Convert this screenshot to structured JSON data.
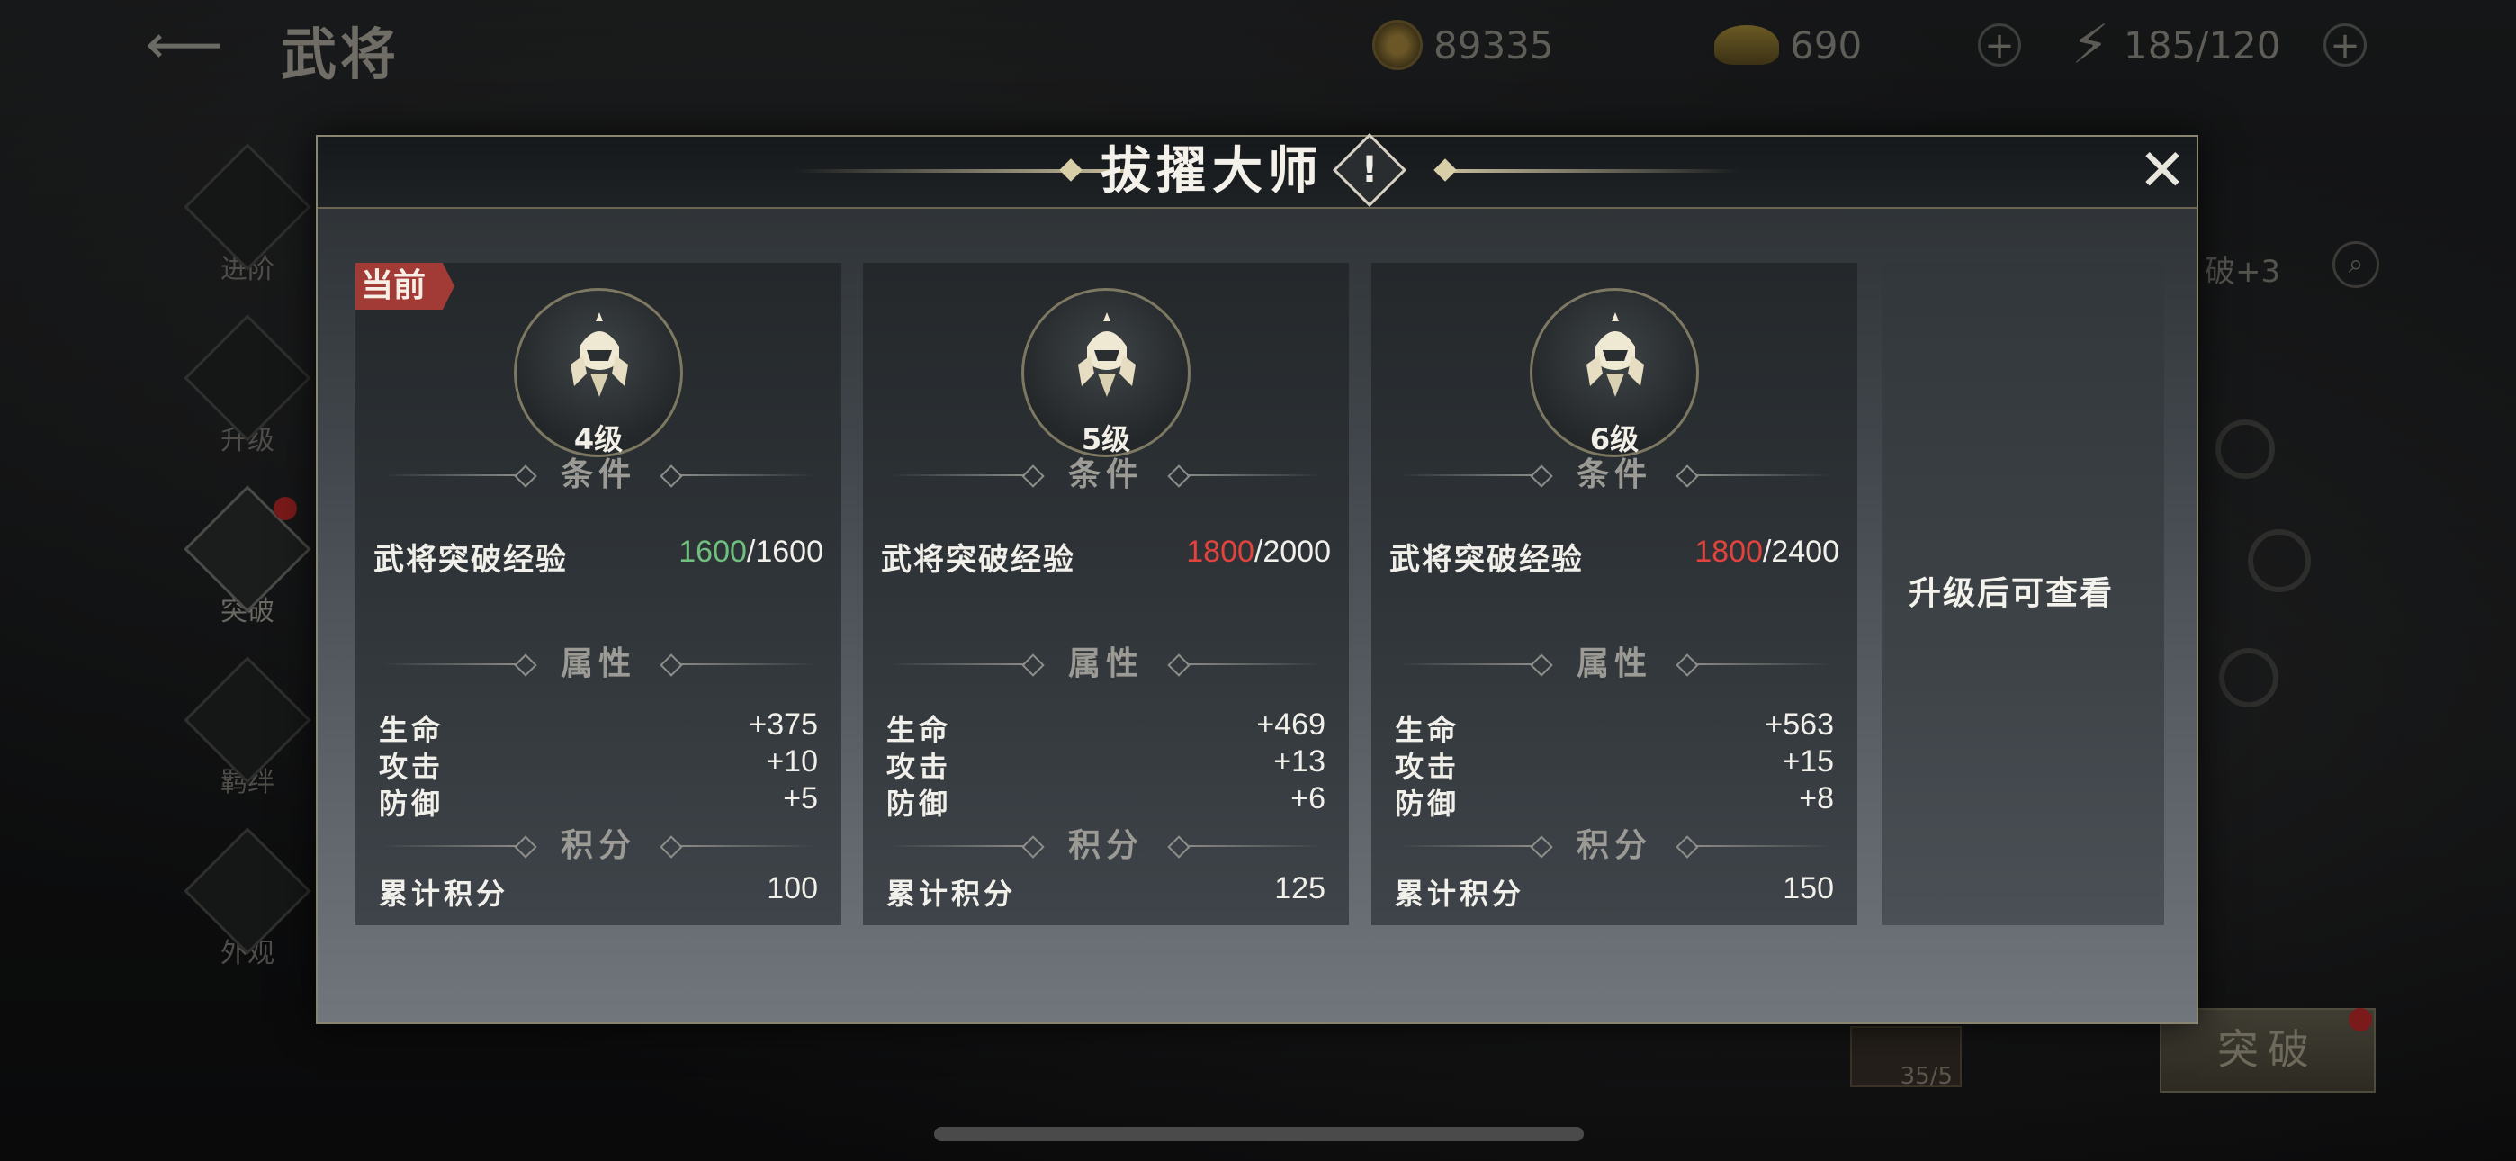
{
  "background": {
    "page_title": "武将",
    "back_icon": "back-arrow-icon",
    "resources": {
      "coins": "89335",
      "ingots": "690",
      "stamina": "185/120"
    },
    "side_nav": [
      "进阶",
      "升级",
      "突破",
      "羁绊",
      "外观"
    ],
    "right_label": "破+3",
    "breakthrough_button": "突破",
    "portrait_count": "35/5"
  },
  "modal": {
    "title": "拔擢大师",
    "info_icon": "!",
    "close_icon": "✕",
    "current_tag": "当前",
    "cards": [
      {
        "level": "4级",
        "condition_header": "条件",
        "condition_label": "武将突破经验",
        "condition_current": "1600",
        "condition_total": "/1600",
        "condition_met": true,
        "attr_header": "属性",
        "attrs": [
          {
            "name": "生命",
            "value": "+375"
          },
          {
            "name": "攻击",
            "value": "+10"
          },
          {
            "name": "防御",
            "value": "+5"
          }
        ],
        "score_header": "积分",
        "score_label": "累计积分",
        "score_value": "100"
      },
      {
        "level": "5级",
        "condition_header": "条件",
        "condition_label": "武将突破经验",
        "condition_current": "1800",
        "condition_total": "/2000",
        "condition_met": false,
        "attr_header": "属性",
        "attrs": [
          {
            "name": "生命",
            "value": "+469"
          },
          {
            "name": "攻击",
            "value": "+13"
          },
          {
            "name": "防御",
            "value": "+6"
          }
        ],
        "score_header": "积分",
        "score_label": "累计积分",
        "score_value": "125"
      },
      {
        "level": "6级",
        "condition_header": "条件",
        "condition_label": "武将突破经验",
        "condition_current": "1800",
        "condition_total": "/2400",
        "condition_met": false,
        "attr_header": "属性",
        "attrs": [
          {
            "name": "生命",
            "value": "+563"
          },
          {
            "name": "攻击",
            "value": "+15"
          },
          {
            "name": "防御",
            "value": "+8"
          }
        ],
        "score_header": "积分",
        "score_label": "累计积分",
        "score_value": "150"
      }
    ],
    "locked_card_text": "升级后可查看"
  },
  "colors": {
    "met": "#6fbf7e",
    "unmet": "#e2433d",
    "tag": "#a23a36",
    "gold_border": "#8a8570"
  }
}
